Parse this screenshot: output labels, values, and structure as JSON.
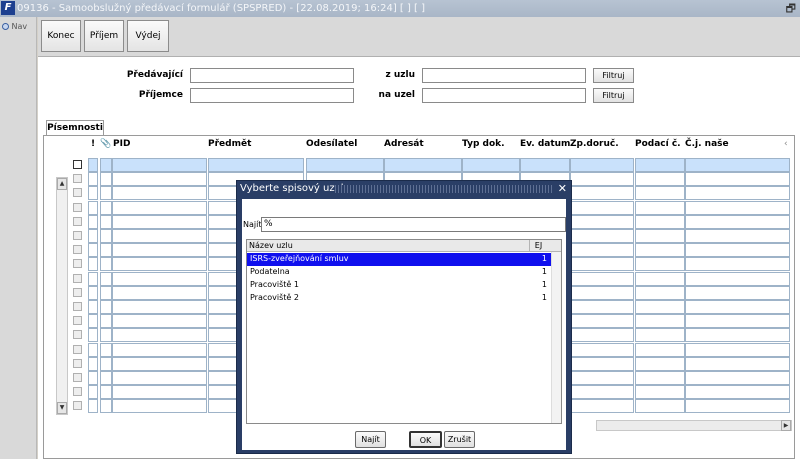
{
  "window": {
    "title": "09136 - Samoobslužný předávací formulář (SPSPRED) - [22.08.2019; 16:24]  [ ]  [ ]",
    "app_icon": "F",
    "restore_glyph": "🗗"
  },
  "nav": {
    "label": "Nav"
  },
  "toolbar": {
    "konec": "Konec",
    "prijem": "Příjem",
    "vydej": "Výdej"
  },
  "filters": {
    "predavajici_label": "Předávající",
    "prijemce_label": "Příjemce",
    "z_uzlu_label": "z uzlu",
    "na_uzel_label": "na uzel",
    "filtruj1": "Filtruj",
    "filtruj2": "Filtruj",
    "predavajici_value": "",
    "prijemce_value": "",
    "z_uzlu_value": "",
    "na_uzel_value": ""
  },
  "tab": {
    "label": "Písemnosti"
  },
  "grid": {
    "headers": {
      "flag": "!",
      "attach": "📎",
      "pid": "PID",
      "predmet": "Předmět",
      "odesilatel": "Odesílatel",
      "adresat": "Adresát",
      "typ": "Typ dok.",
      "ev_datum": "Ev. datum",
      "zp_doruc": "Zp.doruč.",
      "podaci": "Podací č.",
      "cj": "Č.j. naše",
      "more": "‹"
    }
  },
  "dialog": {
    "title": "Vyberte spisový uzel",
    "close": "✕",
    "find_label": "Najít",
    "find_value": "%",
    "col_name": "Název uzlu",
    "col_ej": "EJ",
    "rows": [
      {
        "name": "ISRS-zveřejňování smluv",
        "ej": "1"
      },
      {
        "name": "Podatelna",
        "ej": "1"
      },
      {
        "name": "Pracoviště 1",
        "ej": "1"
      },
      {
        "name": "Pracoviště 2",
        "ej": "1"
      }
    ],
    "btn_najit": "Najít",
    "btn_ok": "OK",
    "btn_zrusit": "Zrušit"
  }
}
